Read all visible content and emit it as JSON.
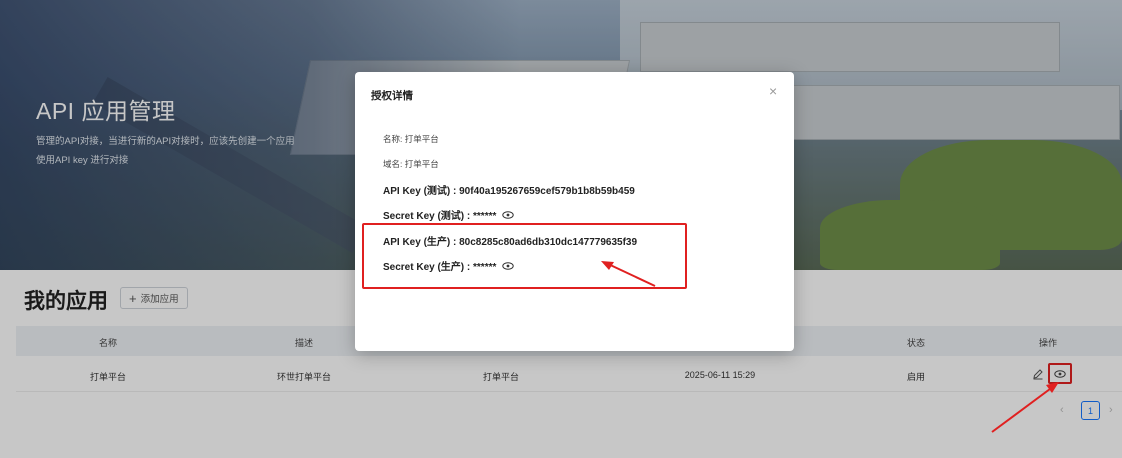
{
  "hero": {
    "title": "API 应用管理",
    "description_line1": "管理的API对接，当进行新的API对接时，应该先创建一个应用",
    "description_line2": "使用API key 进行对接"
  },
  "section": {
    "title": "我的应用",
    "add_button": "添加应用"
  },
  "table": {
    "headers": [
      "名称",
      "描述",
      "",
      "",
      "状态",
      "操作"
    ],
    "rows": [
      {
        "name": "打单平台",
        "description": "环世打单平台",
        "domain": "打单平台",
        "created": "2025-06-11 15:29",
        "status": "启用"
      }
    ]
  },
  "pagination": {
    "prev": "‹",
    "current_page": "1",
    "next": "›"
  },
  "modal": {
    "title": "授权详情",
    "close": "×",
    "name_line": "名称: 打单平台",
    "domain_line": "域名: 打单平台",
    "api_key_test": "API Key (测试) : 90f40a195267659cef579b1b8b59b459",
    "secret_key_test": "Secret Key (测试) : ******",
    "api_key_prod": "API Key (生产) : 80c8285c80ad6db310dc147779635f39",
    "secret_key_prod": "Secret Key (生产) : ******"
  },
  "icons": [
    "close-icon",
    "plus-icon",
    "edit-icon",
    "eye-icon"
  ],
  "colors": {
    "annotation_red": "#e02020",
    "primary_blue": "#1677ff",
    "table_header_bg": "#eef1f5"
  }
}
